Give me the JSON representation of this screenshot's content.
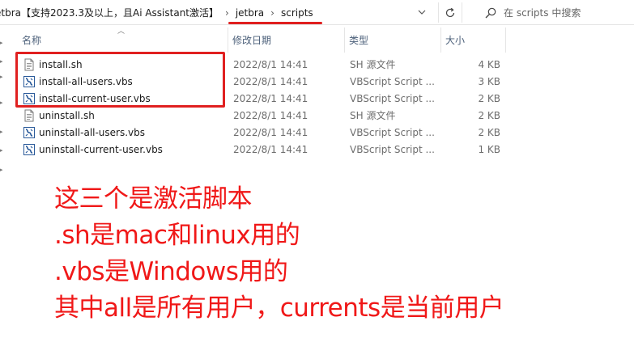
{
  "address_bar": {
    "breadcrumbs": [
      "etbra【支持2023.3及以上，且Ai Assistant激活】",
      "jetbra",
      "scripts"
    ],
    "search_placeholder": "在 scripts 中搜索"
  },
  "columns": {
    "name": "名称",
    "date": "修改日期",
    "type": "类型",
    "size": "大小"
  },
  "files": [
    {
      "name": "install.sh",
      "date": "2022/8/1 14:41",
      "type": "SH 源文件",
      "size": "4 KB",
      "icon": "sh-file-icon"
    },
    {
      "name": "install-all-users.vbs",
      "date": "2022/8/1 14:41",
      "type": "VBScript Script ...",
      "size": "3 KB",
      "icon": "vbs-file-icon"
    },
    {
      "name": "install-current-user.vbs",
      "date": "2022/8/1 14:41",
      "type": "VBScript Script ...",
      "size": "2 KB",
      "icon": "vbs-file-icon"
    },
    {
      "name": "uninstall.sh",
      "date": "2022/8/1 14:41",
      "type": "SH 源文件",
      "size": "2 KB",
      "icon": "sh-file-icon"
    },
    {
      "name": "uninstall-all-users.vbs",
      "date": "2022/8/1 14:41",
      "type": "VBScript Script ...",
      "size": "2 KB",
      "icon": "vbs-file-icon"
    },
    {
      "name": "uninstall-current-user.vbs",
      "date": "2022/8/1 14:41",
      "type": "VBScript Script ...",
      "size": "1 KB",
      "icon": "vbs-file-icon"
    }
  ],
  "annotation": {
    "lines": [
      "这三个是激活脚本",
      ".sh是mac和linux用的",
      ".vbs是Windows用的",
      "其中all是所有用户，currents是当前用户"
    ]
  },
  "colors": {
    "highlight_red": "#e02020",
    "annotation_red": "#f01818",
    "header_text": "#4c607a"
  }
}
